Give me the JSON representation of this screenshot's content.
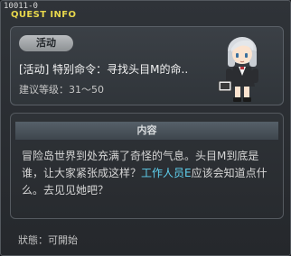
{
  "window": {
    "id": "10011-0",
    "title": "QUEST INFO"
  },
  "quest": {
    "category": "活动",
    "title": "[活动] 特别命令：寻找头目M的命..",
    "level_req": "建议等级：31～50"
  },
  "content": {
    "header": "内容",
    "desc_part1": "冒险岛世界到处充满了奇怪的气息。头目M到底是谁，让大家紧张成这样？",
    "desc_highlight": "工作人员E",
    "desc_part2": "应该会知道点什么。去见见她吧？"
  },
  "status": "狀態：可開始",
  "colors": {
    "title": "#e6d64c",
    "highlight": "#5fd0ee"
  },
  "npc": {
    "icon": "npc-portrait"
  }
}
